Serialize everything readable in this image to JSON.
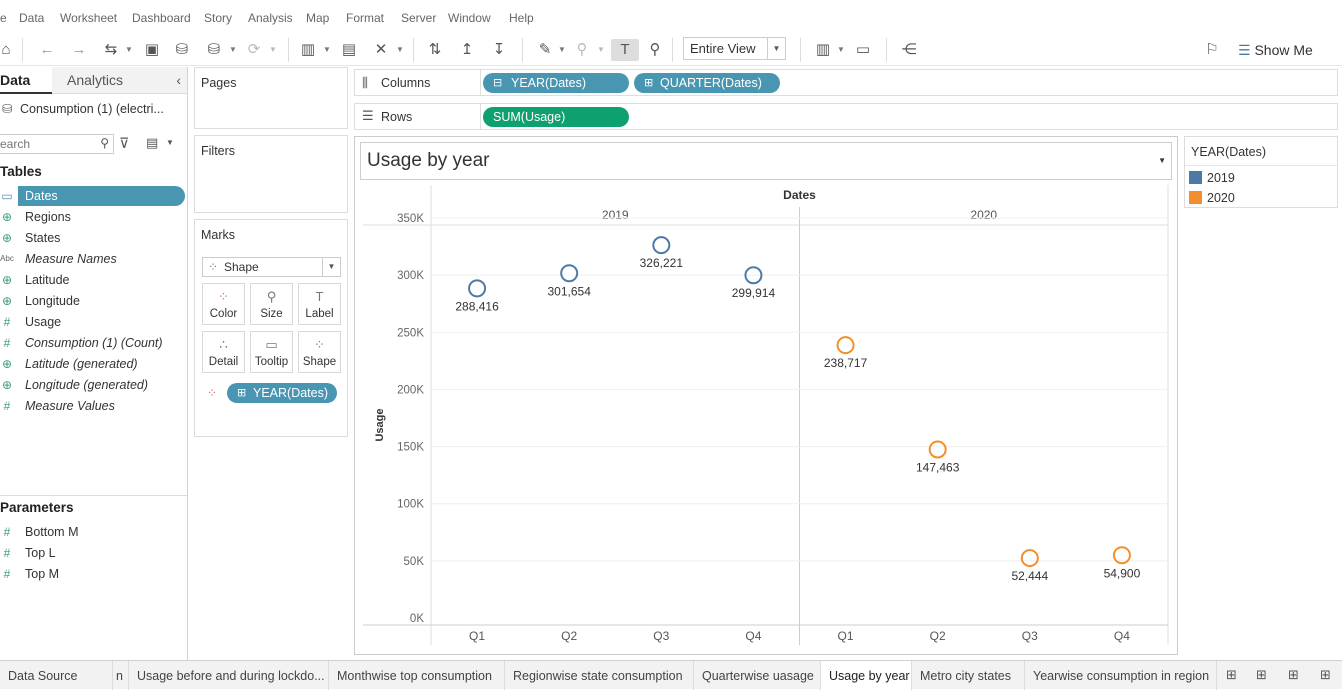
{
  "menu": [
    "e",
    "Data",
    "Worksheet",
    "Dashboard",
    "Story",
    "Analysis",
    "Map",
    "Format",
    "Server",
    "Window",
    "Help"
  ],
  "toolbar": {
    "fit_label": "Entire View",
    "show_me": "Show Me"
  },
  "data_pane": {
    "tab_data": "Data",
    "tab_analytics": "Analytics",
    "datasource": "Consumption (1) (electri...",
    "search_placeholder": "earch",
    "tables_heading": "Tables",
    "fields": [
      {
        "icon": "calendar-icon",
        "glyph": "▭",
        "label": "Dates",
        "italic": false,
        "selected": true
      },
      {
        "icon": "globe-icon",
        "glyph": "⊕",
        "label": "Regions",
        "italic": false
      },
      {
        "icon": "globe-icon",
        "glyph": "⊕",
        "label": "States",
        "italic": false
      },
      {
        "icon": "abc-icon",
        "glyph": "Abc",
        "label": "Measure Names",
        "italic": true
      },
      {
        "icon": "globe-icon",
        "glyph": "⊕",
        "label": "Latitude",
        "italic": false
      },
      {
        "icon": "globe-icon",
        "glyph": "⊕",
        "label": "Longitude",
        "italic": false
      },
      {
        "icon": "hash-icon",
        "glyph": "#",
        "label": "Usage",
        "italic": false
      },
      {
        "icon": "hash-icon",
        "glyph": "#",
        "label": "Consumption (1) (Count)",
        "italic": true
      },
      {
        "icon": "globe-icon",
        "glyph": "⊕",
        "label": "Latitude (generated)",
        "italic": true
      },
      {
        "icon": "globe-icon",
        "glyph": "⊕",
        "label": "Longitude (generated)",
        "italic": true
      },
      {
        "icon": "hash-icon",
        "glyph": "#",
        "label": "Measure Values",
        "italic": true
      }
    ],
    "parameters_heading": "Parameters",
    "parameters": [
      {
        "icon": "hash-icon",
        "glyph": "#",
        "label": "Bottom M"
      },
      {
        "icon": "hash-icon",
        "glyph": "#",
        "label": "Top L"
      },
      {
        "icon": "hash-icon",
        "glyph": "#",
        "label": "Top M"
      }
    ]
  },
  "shelves": {
    "pages": "Pages",
    "filters": "Filters",
    "marks": "Marks",
    "mark_type": "Shape",
    "mark_buttons": [
      {
        "label": "Color",
        "icon": "color-icon"
      },
      {
        "label": "Size",
        "icon": "size-icon"
      },
      {
        "label": "Label",
        "icon": "label-icon"
      },
      {
        "label": "Detail",
        "icon": "detail-icon"
      },
      {
        "label": "Tooltip",
        "icon": "tooltip-icon"
      },
      {
        "label": "Shape",
        "icon": "shape-icon"
      }
    ],
    "mark_pill": "YEAR(Dates)",
    "columns_label": "Columns",
    "rows_label": "Rows",
    "column_pills": [
      "YEAR(Dates)",
      "QUARTER(Dates)"
    ],
    "row_pill": "SUM(Usage)"
  },
  "view": {
    "title": "Usage by year"
  },
  "legend": {
    "title": "YEAR(Dates)",
    "items": [
      {
        "label": "2019",
        "color": "#4e79a7"
      },
      {
        "label": "2020",
        "color": "#f28e2b"
      }
    ]
  },
  "chart_data": {
    "type": "scatter",
    "title": "",
    "header": "Dates",
    "ylabel": "Usage",
    "ylim": [
      0,
      350000
    ],
    "yticks": [
      "0K",
      "50K",
      "100K",
      "150K",
      "200K",
      "250K",
      "300K",
      "350K"
    ],
    "panels": [
      "2019",
      "2020"
    ],
    "categories": [
      "Q1",
      "Q2",
      "Q3",
      "Q4"
    ],
    "series": [
      {
        "name": "2019",
        "color": "#4e79a7",
        "values": [
          288416,
          301654,
          326221,
          299914
        ],
        "labels": [
          "288,416",
          "301,654",
          "326,221",
          "299,914"
        ]
      },
      {
        "name": "2020",
        "color": "#f28e2b",
        "values": [
          238717,
          147463,
          52444,
          54900
        ],
        "labels": [
          "238,717",
          "147,463",
          "52,444",
          "54,900"
        ]
      }
    ],
    "grid": true,
    "legend": "right"
  },
  "tabs": [
    {
      "label": "Data Source",
      "active": false
    },
    {
      "label": "n",
      "active": false
    },
    {
      "label": "Usage before and during lockdo...",
      "active": false
    },
    {
      "label": "Monthwise top consumption",
      "active": false
    },
    {
      "label": "Regionwise state consumption",
      "active": false
    },
    {
      "label": "Quarterwise uasage",
      "active": false
    },
    {
      "label": "Usage by year",
      "active": true
    },
    {
      "label": "Metro city states",
      "active": false
    },
    {
      "label": "Yearwise consumption in region",
      "active": false
    }
  ]
}
